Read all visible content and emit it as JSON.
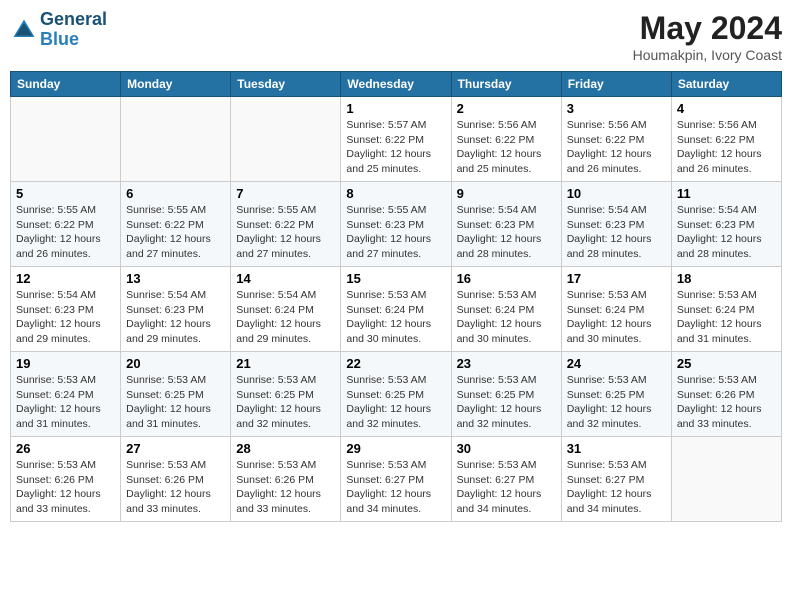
{
  "header": {
    "logo_blue": "Blue",
    "month_year": "May 2024",
    "location": "Houmakpin, Ivory Coast"
  },
  "calendar": {
    "days": [
      "Sunday",
      "Monday",
      "Tuesday",
      "Wednesday",
      "Thursday",
      "Friday",
      "Saturday"
    ]
  },
  "weeks": [
    [
      {
        "day": "",
        "info": ""
      },
      {
        "day": "",
        "info": ""
      },
      {
        "day": "",
        "info": ""
      },
      {
        "day": "1",
        "info": "Sunrise: 5:57 AM\nSunset: 6:22 PM\nDaylight: 12 hours\nand 25 minutes."
      },
      {
        "day": "2",
        "info": "Sunrise: 5:56 AM\nSunset: 6:22 PM\nDaylight: 12 hours\nand 25 minutes."
      },
      {
        "day": "3",
        "info": "Sunrise: 5:56 AM\nSunset: 6:22 PM\nDaylight: 12 hours\nand 26 minutes."
      },
      {
        "day": "4",
        "info": "Sunrise: 5:56 AM\nSunset: 6:22 PM\nDaylight: 12 hours\nand 26 minutes."
      }
    ],
    [
      {
        "day": "5",
        "info": "Sunrise: 5:55 AM\nSunset: 6:22 PM\nDaylight: 12 hours\nand 26 minutes."
      },
      {
        "day": "6",
        "info": "Sunrise: 5:55 AM\nSunset: 6:22 PM\nDaylight: 12 hours\nand 27 minutes."
      },
      {
        "day": "7",
        "info": "Sunrise: 5:55 AM\nSunset: 6:22 PM\nDaylight: 12 hours\nand 27 minutes."
      },
      {
        "day": "8",
        "info": "Sunrise: 5:55 AM\nSunset: 6:23 PM\nDaylight: 12 hours\nand 27 minutes."
      },
      {
        "day": "9",
        "info": "Sunrise: 5:54 AM\nSunset: 6:23 PM\nDaylight: 12 hours\nand 28 minutes."
      },
      {
        "day": "10",
        "info": "Sunrise: 5:54 AM\nSunset: 6:23 PM\nDaylight: 12 hours\nand 28 minutes."
      },
      {
        "day": "11",
        "info": "Sunrise: 5:54 AM\nSunset: 6:23 PM\nDaylight: 12 hours\nand 28 minutes."
      }
    ],
    [
      {
        "day": "12",
        "info": "Sunrise: 5:54 AM\nSunset: 6:23 PM\nDaylight: 12 hours\nand 29 minutes."
      },
      {
        "day": "13",
        "info": "Sunrise: 5:54 AM\nSunset: 6:23 PM\nDaylight: 12 hours\nand 29 minutes."
      },
      {
        "day": "14",
        "info": "Sunrise: 5:54 AM\nSunset: 6:24 PM\nDaylight: 12 hours\nand 29 minutes."
      },
      {
        "day": "15",
        "info": "Sunrise: 5:53 AM\nSunset: 6:24 PM\nDaylight: 12 hours\nand 30 minutes."
      },
      {
        "day": "16",
        "info": "Sunrise: 5:53 AM\nSunset: 6:24 PM\nDaylight: 12 hours\nand 30 minutes."
      },
      {
        "day": "17",
        "info": "Sunrise: 5:53 AM\nSunset: 6:24 PM\nDaylight: 12 hours\nand 30 minutes."
      },
      {
        "day": "18",
        "info": "Sunrise: 5:53 AM\nSunset: 6:24 PM\nDaylight: 12 hours\nand 31 minutes."
      }
    ],
    [
      {
        "day": "19",
        "info": "Sunrise: 5:53 AM\nSunset: 6:24 PM\nDaylight: 12 hours\nand 31 minutes."
      },
      {
        "day": "20",
        "info": "Sunrise: 5:53 AM\nSunset: 6:25 PM\nDaylight: 12 hours\nand 31 minutes."
      },
      {
        "day": "21",
        "info": "Sunrise: 5:53 AM\nSunset: 6:25 PM\nDaylight: 12 hours\nand 32 minutes."
      },
      {
        "day": "22",
        "info": "Sunrise: 5:53 AM\nSunset: 6:25 PM\nDaylight: 12 hours\nand 32 minutes."
      },
      {
        "day": "23",
        "info": "Sunrise: 5:53 AM\nSunset: 6:25 PM\nDaylight: 12 hours\nand 32 minutes."
      },
      {
        "day": "24",
        "info": "Sunrise: 5:53 AM\nSunset: 6:25 PM\nDaylight: 12 hours\nand 32 minutes."
      },
      {
        "day": "25",
        "info": "Sunrise: 5:53 AM\nSunset: 6:26 PM\nDaylight: 12 hours\nand 33 minutes."
      }
    ],
    [
      {
        "day": "26",
        "info": "Sunrise: 5:53 AM\nSunset: 6:26 PM\nDaylight: 12 hours\nand 33 minutes."
      },
      {
        "day": "27",
        "info": "Sunrise: 5:53 AM\nSunset: 6:26 PM\nDaylight: 12 hours\nand 33 minutes."
      },
      {
        "day": "28",
        "info": "Sunrise: 5:53 AM\nSunset: 6:26 PM\nDaylight: 12 hours\nand 33 minutes."
      },
      {
        "day": "29",
        "info": "Sunrise: 5:53 AM\nSunset: 6:27 PM\nDaylight: 12 hours\nand 34 minutes."
      },
      {
        "day": "30",
        "info": "Sunrise: 5:53 AM\nSunset: 6:27 PM\nDaylight: 12 hours\nand 34 minutes."
      },
      {
        "day": "31",
        "info": "Sunrise: 5:53 AM\nSunset: 6:27 PM\nDaylight: 12 hours\nand 34 minutes."
      },
      {
        "day": "",
        "info": ""
      }
    ]
  ]
}
